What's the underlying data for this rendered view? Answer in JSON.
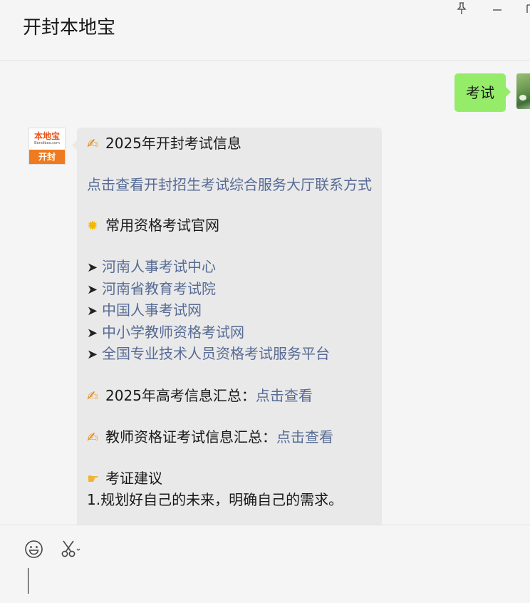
{
  "header": {
    "title": "开封本地宝",
    "pin_icon": "pin-icon",
    "minimize_icon": "minimize-icon",
    "maximize_icon": "maximize-icon"
  },
  "messages": {
    "outgoing": {
      "text": "考试",
      "bubble_color": "#95ec69",
      "avatar_icon": "user-avatar"
    },
    "incoming": {
      "bubble_color": "#e9e9e9",
      "link_color": "#576b95",
      "avatar": {
        "brand": "本地宝",
        "domain": "Bendibao.com",
        "city": "开封",
        "brand_color": "#e8541e",
        "city_bg": "#f07a1e"
      },
      "heading_icon": "pencil-icon",
      "heading": "2025年开封考试信息",
      "service_hall_link": "点击查看开封招生考试综合服务大厅联系方式",
      "official_sites_icon": "sun-icon",
      "official_sites_heading": "常用资格考试官网",
      "arrow": "➤",
      "sites": [
        "河南人事考试中心",
        "河南省教育考试院",
        "中国人事考试网",
        "中小学教师资格考试网",
        "全国专业技术人员资格考试服务平台"
      ],
      "gaokao": {
        "icon": "pencil-icon",
        "label": "2025年高考信息汇总：",
        "link": "点击查看"
      },
      "teacher": {
        "icon": "pencil-icon",
        "label": "教师资格证考试信息汇总：",
        "link": "点击查看"
      },
      "advice": {
        "icon": "pointing-hand-icon",
        "heading": "考证建议",
        "item_1": "1.规划好自己的未来，明确自己的需求。"
      }
    }
  },
  "input": {
    "emoji_icon": "smiley-icon",
    "screenshot_icon": "scissors-icon",
    "value": ""
  }
}
